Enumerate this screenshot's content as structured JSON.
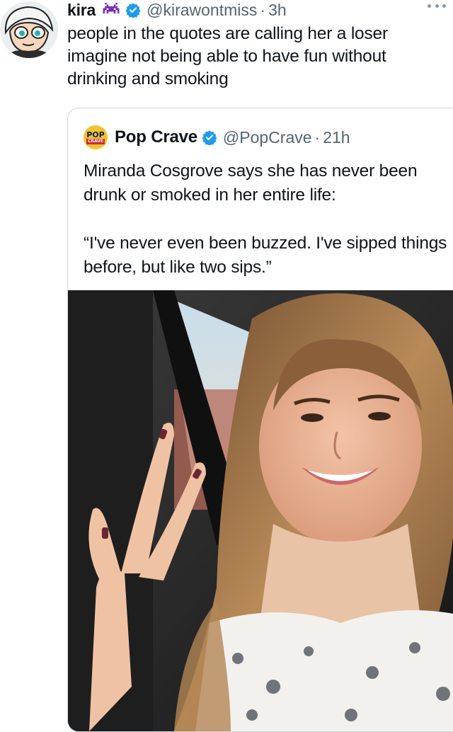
{
  "tweet": {
    "author_name": "kira",
    "author_handle": "@kirawontmiss",
    "time": "3h",
    "emoji_icon": "space-invader-icon",
    "text": "people in the quotes are calling her a loser imagine not being able to have fun without drinking and smoking"
  },
  "quoted_tweet": {
    "author_name": "Pop Crave",
    "author_handle": "@PopCrave",
    "time": "21h",
    "logo_top": "POP",
    "logo_bottom": "CRAVE",
    "text_line_1": "Miranda Cosgrove says she has never been drunk or smoked in her entire life:",
    "text_line_2": "“I've never even been buzzed. I've sipped things before, but like two sips.”"
  },
  "colors": {
    "verified": "#1d9bf0",
    "secondary_text": "#536471",
    "border": "#cfd9de",
    "emoji": "#7b2cbf"
  }
}
